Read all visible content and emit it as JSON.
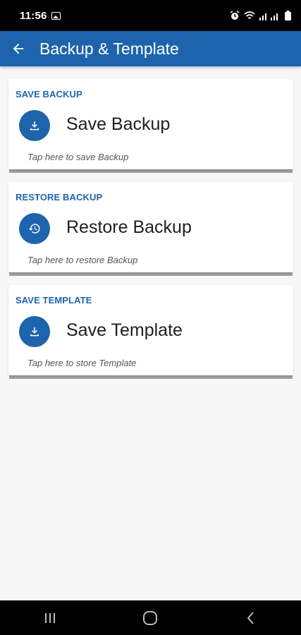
{
  "status_bar": {
    "time": "11:56"
  },
  "app_bar": {
    "title": "Backup & Template"
  },
  "cards": [
    {
      "section_label": "SAVE BACKUP",
      "title": "Save Backup",
      "subtitle": "Tap here to save Backup",
      "icon": "download-icon"
    },
    {
      "section_label": "RESTORE BACKUP",
      "title": "Restore Backup",
      "subtitle": "Tap here to restore Backup",
      "icon": "history-icon"
    },
    {
      "section_label": "SAVE TEMPLATE",
      "title": "Save Template",
      "subtitle": "Tap here to store Template",
      "icon": "download-icon"
    }
  ],
  "colors": {
    "primary": "#1d64ad",
    "background": "#f7f7f7"
  }
}
